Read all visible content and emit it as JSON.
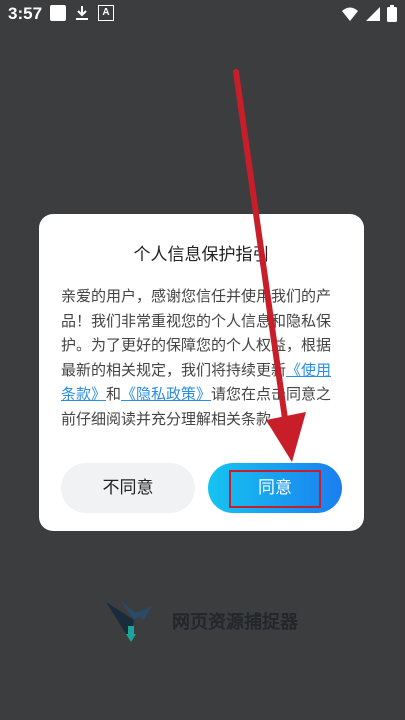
{
  "status_bar": {
    "time": "3:57",
    "a_icon": "A"
  },
  "dialog": {
    "title": "个人信息保护指引",
    "body_p1": "亲爱的用户，感谢您信任并使用我们的产品！我们非常重视您的个人信息和隐私保护。为了更好的保障您的个人权益，根据最新的相关规定，我们将持续更新",
    "terms_link": "《使用条款》",
    "and_text": "和",
    "privacy_link": "《隐私政策》",
    "body_p2": "请您在点击同意之前仔细阅读并充分理解相关条款。",
    "disagree_label": "不同意",
    "agree_label": "同意"
  },
  "brand": {
    "title": "网页资源捕捉器"
  },
  "colors": {
    "backdrop": "#3b3d3f",
    "link": "#2a8de6",
    "agree_gradient_start": "#16c4f0",
    "agree_gradient_end": "#1b7ef0",
    "annotation_red": "#c81e2a"
  }
}
